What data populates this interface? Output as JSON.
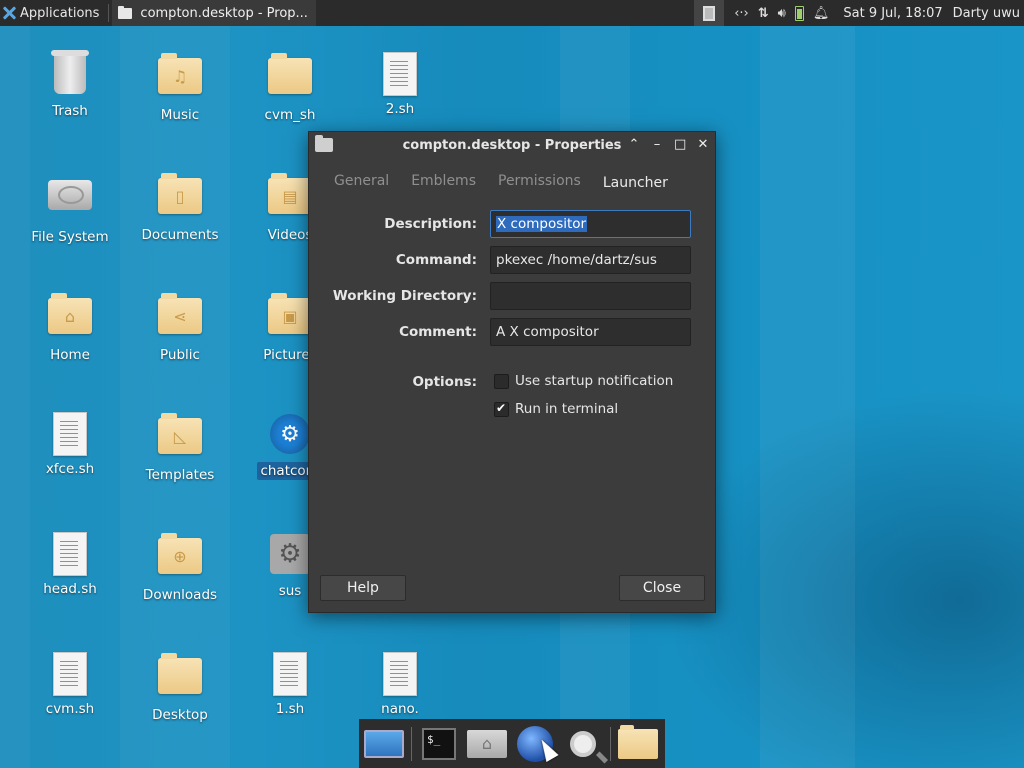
{
  "top_panel": {
    "applications_label": "Applications",
    "task_title": "compton.desktop - Prop...",
    "clock": "Sat  9 Jul, 18:07",
    "user": "Darty uwu"
  },
  "desktop_icons": [
    {
      "label": "Trash"
    },
    {
      "label": "Music"
    },
    {
      "label": "cvm_sh"
    },
    {
      "label": "2.sh"
    },
    {
      "label": "File System"
    },
    {
      "label": "Documents"
    },
    {
      "label": "Videos"
    },
    {
      "label": "Home"
    },
    {
      "label": "Public"
    },
    {
      "label": "Pictures"
    },
    {
      "label": "xfce.sh"
    },
    {
      "label": "Templates"
    },
    {
      "label": "chatcont"
    },
    {
      "label": "head.sh"
    },
    {
      "label": "Downloads"
    },
    {
      "label": "sus"
    },
    {
      "label": "cvm.sh"
    },
    {
      "label": "Desktop"
    },
    {
      "label": "1.sh"
    },
    {
      "label": "nano."
    }
  ],
  "dialog": {
    "title": "compton.desktop - Properties",
    "tabs": [
      "General",
      "Emblems",
      "Permissions",
      "Launcher"
    ],
    "active_tab": "Launcher",
    "fields": {
      "description": {
        "label": "Description:",
        "value": "X compositor"
      },
      "command": {
        "label": "Command:",
        "value": "pkexec /home/dartz/sus"
      },
      "working_directory": {
        "label": "Working Directory:",
        "value": ""
      },
      "comment": {
        "label": "Comment:",
        "value": "A X compositor"
      }
    },
    "options": {
      "label": "Options:",
      "startup_notification": {
        "label": "Use startup notification",
        "checked": false
      },
      "run_in_terminal": {
        "label": "Run in terminal",
        "checked": true
      }
    },
    "help_button": "Help",
    "close_button": "Close"
  },
  "dock": {
    "terminal_prompt": "$_"
  }
}
